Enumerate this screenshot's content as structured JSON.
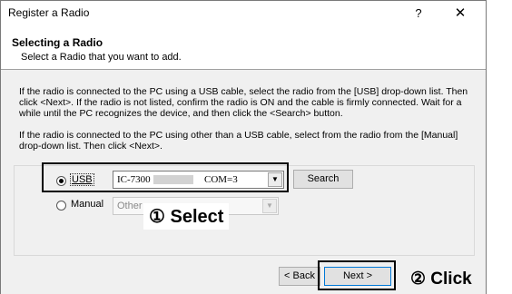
{
  "window": {
    "title": "Register a Radio",
    "help_glyph": "?",
    "close_glyph": "✕"
  },
  "header": {
    "heading": "Selecting a Radio",
    "subheading": "Select a Radio that you want to add."
  },
  "instructions": {
    "usb_paragraph": "If the radio is connected to the PC using a USB cable, select the radio from the [USB] drop-down list. Then click <Next>. If the radio is not listed, confirm the radio is ON and the cable is firmly connected. Wait for a while until the PC recognizes the device, and then click the <Search> button.",
    "manual_paragraph": "If the radio is connected to the PC using other than a USB cable, select from the radio from the [Manual] drop-down list. Then click <Next>."
  },
  "usb_option": {
    "label": "USB",
    "selected": true,
    "model_value": "IC-7300",
    "port_value": "COM=3"
  },
  "manual_option": {
    "label": "Manual",
    "selected": false,
    "value": "Other"
  },
  "buttons": {
    "search": "Search",
    "back": "< Back",
    "next": "Next >"
  },
  "annotations": {
    "select": "① Select",
    "click": "② Click"
  },
  "icons": {
    "dropdown": "chevron-down-icon",
    "close": "close-icon",
    "help": "help-icon"
  }
}
